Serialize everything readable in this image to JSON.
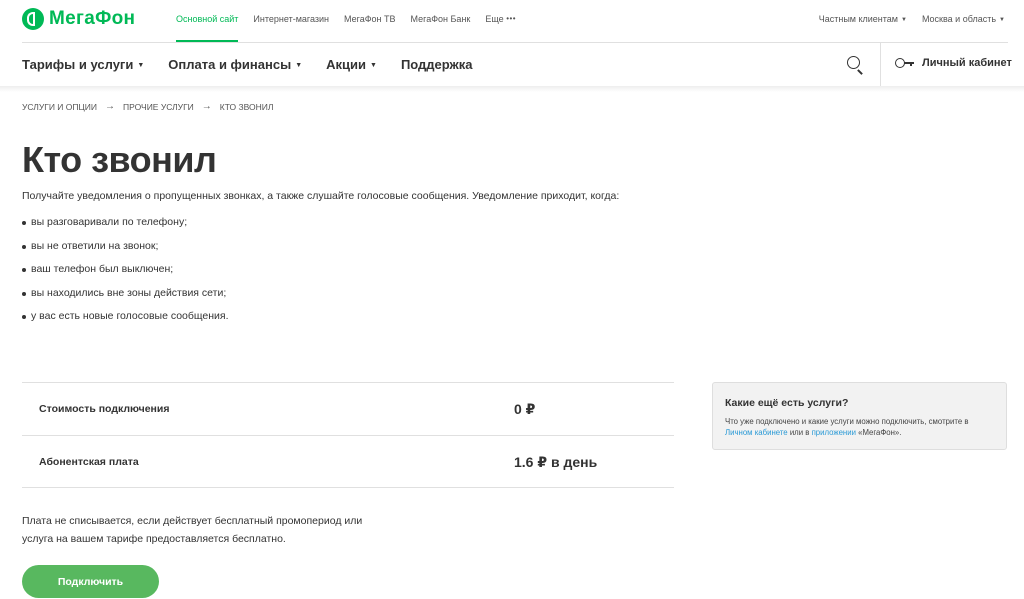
{
  "brand": {
    "name": "МегаФон",
    "color": "#00b956"
  },
  "topnav": {
    "items": [
      {
        "label": "Основной сайт",
        "active": true
      },
      {
        "label": "Интернет-магазин"
      },
      {
        "label": "МегаФон ТВ"
      },
      {
        "label": "МегаФон Банк"
      },
      {
        "label": "Еще"
      }
    ],
    "more_dots": "•••",
    "audience": "Частным клиентам",
    "region": "Москва и область"
  },
  "mainnav": {
    "items": [
      {
        "label": "Тарифы и услуги",
        "has_dropdown": true
      },
      {
        "label": "Оплата и финансы",
        "has_dropdown": true
      },
      {
        "label": "Акции",
        "has_dropdown": true
      },
      {
        "label": "Поддержка",
        "has_dropdown": false
      }
    ],
    "search_icon": "search-icon",
    "cabinet_label": "Личный кабинет",
    "cabinet_icon": "key-icon"
  },
  "breadcrumb": {
    "items": [
      "УСЛУГИ И ОПЦИИ",
      "ПРОЧИЕ УСЛУГИ",
      "КТО ЗВОНИЛ"
    ],
    "separator": "→"
  },
  "page": {
    "title": "Кто звонил",
    "intro": "Получайте уведомления о пропущенных звонках, а также слушайте голосовые сообщения. Уведомление приходит, когда:",
    "bullets": [
      "вы разговаривали по телефону;",
      "вы не ответили на звонок;",
      "ваш телефон был выключен;",
      "вы находились вне зоны действия сети;",
      "у вас есть новые голосовые сообщения."
    ]
  },
  "pricing": {
    "rows": [
      {
        "label": "Стоимость подключения",
        "value": "0 ₽"
      },
      {
        "label": "Абонентская плата",
        "value": "1.6 ₽ в день"
      }
    ]
  },
  "note": "Плата не списывается, если действует бесплатный промопериод или услуга на вашем тарифе предоставляется бесплатно.",
  "connect_button": {
    "label": "Подключить",
    "color": "#58b85f"
  },
  "info_card": {
    "title": "Какие ещё есть услуги?",
    "text_before": "Что уже подключено и какие услуги можно подключить, смотрите в ",
    "link1": "Личном кабинете",
    "text_middle": " или в ",
    "link2": "приложении",
    "text_after": " «МегаФон».",
    "link_color": "#2a9ad6"
  }
}
